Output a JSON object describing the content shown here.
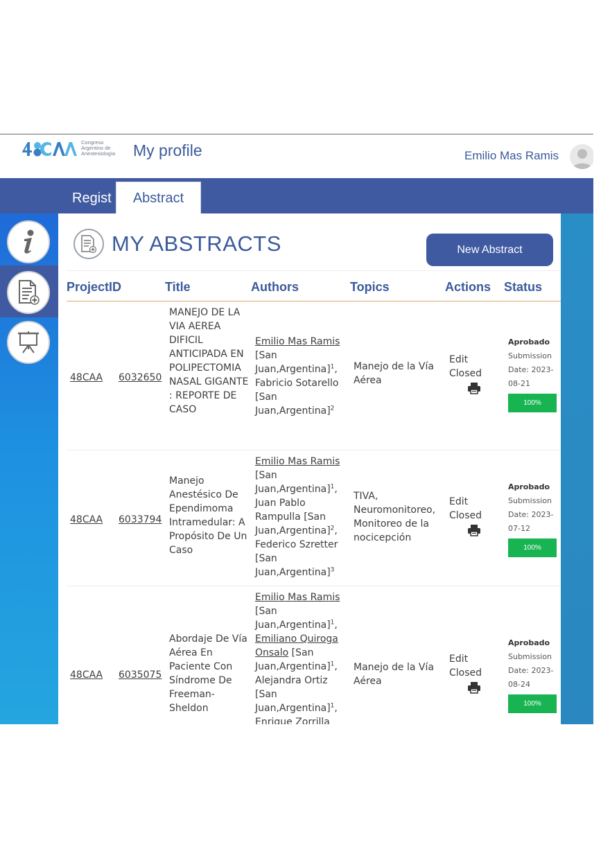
{
  "header": {
    "logo_text": [
      "Congreso",
      "Argentino de",
      "Anestesiología"
    ],
    "page_title": "My profile",
    "user_name": "Emilio Mas Ramis"
  },
  "nav": {
    "items": [
      {
        "label": "Regist"
      },
      {
        "label": "Abstract",
        "active": true
      }
    ]
  },
  "main": {
    "heading": "MY ABSTRACTS",
    "new_button": "New Abstract",
    "columns": [
      "ProjectID",
      "Title",
      "Authors",
      "Topics",
      "Actions",
      "Status"
    ],
    "rows": [
      {
        "code": "48CAA",
        "number": "6032650",
        "title": "MANEJO DE LA VIA AEREA DIFICIL ANTICIPADA EN POLIPECTOMIA NASAL GIGANTE : REPORTE DE CASO",
        "authors_lines": [
          {
            "text": "Emilio Mas Ramis",
            "link": true
          },
          {
            "text": "[San"
          },
          {
            "text": "Juan,Argentina]",
            "sup": "1",
            "after": ","
          },
          {
            "text": "Fabricio Sotarello"
          },
          {
            "text": "[San"
          },
          {
            "text": "Juan,Argentina]",
            "sup": "2"
          }
        ],
        "topics": "Manejo de la Vía Aérea",
        "action_edit": "Edit",
        "action_closed": "Closed",
        "status": "Aprobado",
        "submission": "Submission Date: 2023-08-21",
        "progress": "100%"
      },
      {
        "code": "48CAA",
        "number": "6033794",
        "title": "Manejo Anestésico De Ependimoma Intramedular: A Propósito De Un Caso",
        "authors_lines": [
          {
            "text": "Emilio Mas Ramis",
            "link": true
          },
          {
            "text": "[San"
          },
          {
            "text": "Juan,Argentina]",
            "sup": "1",
            "after": ","
          },
          {
            "text": "Juan Pablo"
          },
          {
            "text": "Rampulla [San"
          },
          {
            "text": "Juan,Argentina]",
            "sup": "2",
            "after": ","
          },
          {
            "text": "Federico Szretter"
          },
          {
            "text": "[San"
          },
          {
            "text": "Juan,Argentina]",
            "sup": "3"
          }
        ],
        "topics": "TIVA, Neuromonitoreo, Monitoreo de la nocicepción",
        "action_edit": "Edit",
        "action_closed": "Closed",
        "status": "Aprobado",
        "submission": "Submission Date: 2023-07-12",
        "progress": "100%"
      },
      {
        "code": "48CAA",
        "number": "6035075",
        "title": "Abordaje De Vía Aérea En Paciente Con Síndrome De Freeman-Sheldon",
        "authors_lines": [
          {
            "text": "Emilio Mas Ramis",
            "link": true
          },
          {
            "text": "[San"
          },
          {
            "text": "Juan,Argentina]",
            "sup": "1",
            "after": ","
          },
          {
            "text": "Emiliano Quiroga",
            "link": true
          },
          {
            "text": "Onsalo",
            "link": true,
            "after": " [San"
          },
          {
            "text": "Juan,Argentina]",
            "sup": "1",
            "after": ","
          },
          {
            "text": "Alejandra Ortiz"
          },
          {
            "text": "[San"
          },
          {
            "text": "Juan,Argentina]",
            "sup": "1",
            "after": ","
          },
          {
            "text": "Enrique Zorrilla"
          }
        ],
        "topics": "Manejo de la Vía Aérea",
        "action_edit": "Edit",
        "action_closed": "Closed",
        "status": "Aprobado",
        "submission": "Submission Date: 2023-08-24",
        "progress": "100%"
      }
    ]
  },
  "colors": {
    "brand_blue": "#3f5aa0",
    "title_blue": "#3a5a9b",
    "progress_green": "#18b451",
    "header_rule": "#e2a96a"
  }
}
